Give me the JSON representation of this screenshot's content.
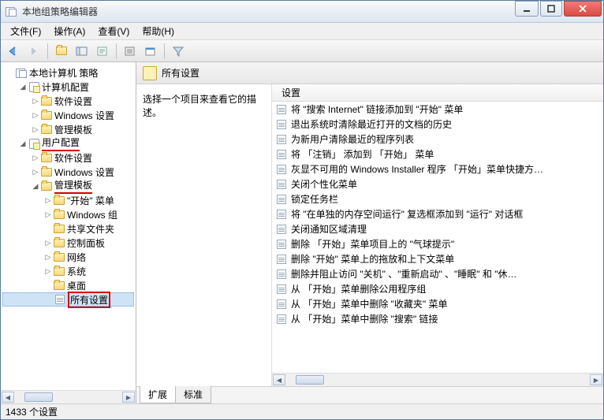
{
  "window": {
    "title": "本地组策略编辑器"
  },
  "menu": {
    "file": "文件(F)",
    "action": "操作(A)",
    "view": "查看(V)",
    "help": "帮助(H)"
  },
  "tree": {
    "root": "本地计算机 策略",
    "computer_cfg": "计算机配置",
    "cc_software": "软件设置",
    "cc_windows": "Windows 设置",
    "cc_admin": "管理模板",
    "user_cfg": "用户配置",
    "uc_software": "软件设置",
    "uc_windows": "Windows 设置",
    "uc_admin": "管理模板",
    "uc_start": "\"开始\" 菜单",
    "uc_wincomp": "Windows 组",
    "uc_share": "共享文件夹",
    "uc_cpl": "控制面板",
    "uc_net": "网络",
    "uc_sys": "系统",
    "uc_desktop": "桌面",
    "uc_all": "所有设置"
  },
  "right": {
    "title": "所有设置",
    "desc": "选择一个项目来查看它的描述。",
    "col_setting": "设置",
    "tabs": {
      "ext": "扩展",
      "std": "标准"
    }
  },
  "settings": [
    "将 \"搜索 Internet\" 链接添加到 \"开始\" 菜单",
    "退出系统时清除最近打开的文档的历史",
    "为新用户清除最近的程序列表",
    "将 「注销」 添加到 「开始」 菜单",
    "灰显不可用的 Windows Installer 程序 「开始」菜单快捷方…",
    "关闭个性化菜单",
    "锁定任务栏",
    "将 \"在单独的内存空间运行\" 复选框添加到 \"运行\" 对话框",
    "关闭通知区域清理",
    "删除 「开始」菜单项目上的 \"气球提示\"",
    "删除 \"开始\" 菜单上的拖放和上下文菜单",
    "删除并阻止访问 \"关机\" 、\"重新启动\" 、\"睡眠\" 和 \"休…",
    "从 「开始」菜单删除公用程序组",
    "从 「开始」菜单中删除 \"收藏夹\" 菜单",
    "从 「开始」菜单中删除 \"搜索\" 链接"
  ],
  "status": "1433 个设置"
}
